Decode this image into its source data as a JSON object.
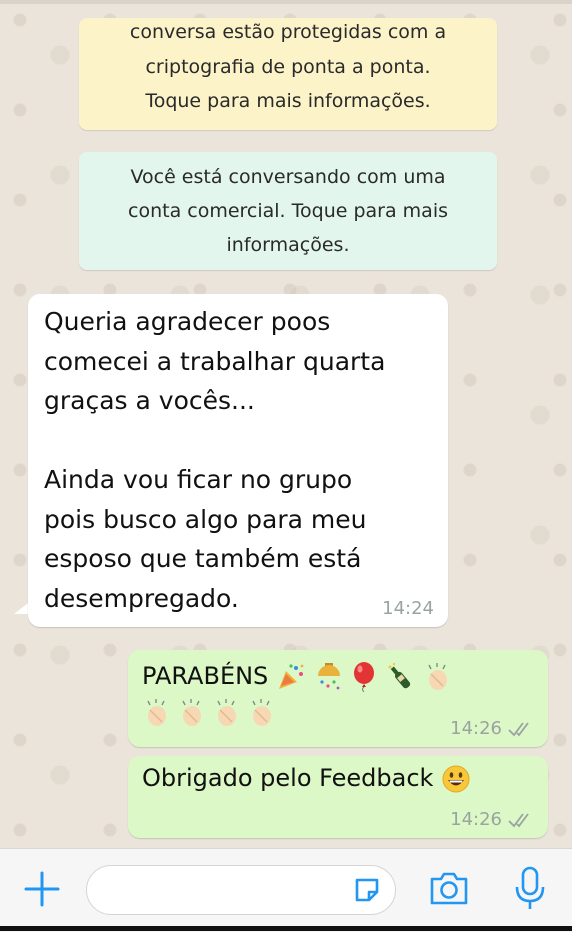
{
  "system_messages": {
    "encryption": [
      "conversa estão protegidas com a",
      "criptografia de ponta a ponta.",
      "Toque para mais informações."
    ],
    "business": [
      "Você está conversando com uma",
      "conta comercial. Toque para mais",
      "informações."
    ]
  },
  "messages": {
    "incoming": {
      "lines": [
        "Queria agradecer poos",
        "comecei a trabalhar quarta",
        "graças a vocês...",
        "",
        "Ainda vou ficar no grupo",
        "pois busco algo para meu",
        "esposo que também está",
        "desempregado."
      ],
      "time": "14:24"
    },
    "outgoing1": {
      "text": "PARABÉNS",
      "time": "14:26"
    },
    "outgoing2": {
      "text": "Obrigado pelo Feedback",
      "time": "14:26"
    }
  },
  "colors": {
    "accent": "#2196f3",
    "outgoing_bubble": "#dcf8c6",
    "incoming_bubble": "#ffffff",
    "encryption_note": "#fcf3c8",
    "business_note": "#e2f6ee"
  },
  "icons": [
    "plus-icon",
    "sticker-icon",
    "camera-icon",
    "microphone-icon",
    "double-check-icon",
    "party-popper-emoji",
    "confetti-ball-emoji",
    "balloon-emoji",
    "champagne-emoji",
    "clapping-hands-emoji",
    "grinning-face-emoji"
  ]
}
